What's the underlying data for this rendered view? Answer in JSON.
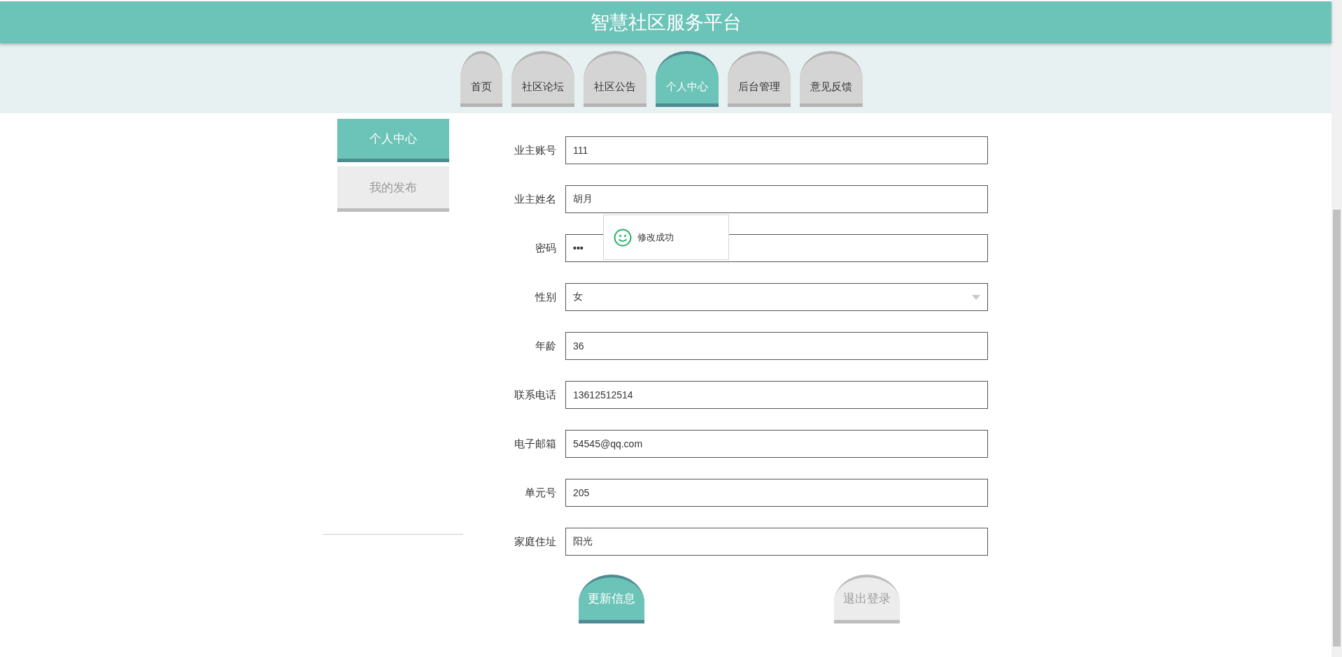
{
  "header": {
    "title": "智慧社区服务平台"
  },
  "nav_tabs": [
    {
      "label": "首页",
      "selected": false
    },
    {
      "label": "社区论坛",
      "selected": false
    },
    {
      "label": "社区公告",
      "selected": false
    },
    {
      "label": "个人中心",
      "selected": true
    },
    {
      "label": "后台管理",
      "selected": false
    },
    {
      "label": "意见反馈",
      "selected": false
    }
  ],
  "sidebar": {
    "items": [
      {
        "label": "个人中心",
        "selected": true
      },
      {
        "label": "我的发布",
        "selected": false
      }
    ]
  },
  "form": {
    "fields": [
      {
        "label": "业主账号",
        "kind": "text",
        "value": "111"
      },
      {
        "label": "业主姓名",
        "kind": "text",
        "value": "胡月"
      },
      {
        "label": "密码",
        "kind": "password",
        "value": "•••"
      },
      {
        "label": "性别",
        "kind": "select",
        "value": "女"
      },
      {
        "label": "年龄",
        "kind": "text",
        "value": "36"
      },
      {
        "label": "联系电话",
        "kind": "text",
        "value": "13612512514"
      },
      {
        "label": "电子邮箱",
        "kind": "text",
        "value": "54545@qq.com"
      },
      {
        "label": "单元号",
        "kind": "text",
        "value": "205"
      },
      {
        "label": "家庭住址",
        "kind": "text",
        "value": "阳光"
      }
    ],
    "buttons": [
      {
        "label": "更新信息",
        "kind": "primary"
      },
      {
        "label": "退出登录",
        "kind": "secondary"
      }
    ]
  },
  "toast": {
    "message": "修改成功"
  }
}
